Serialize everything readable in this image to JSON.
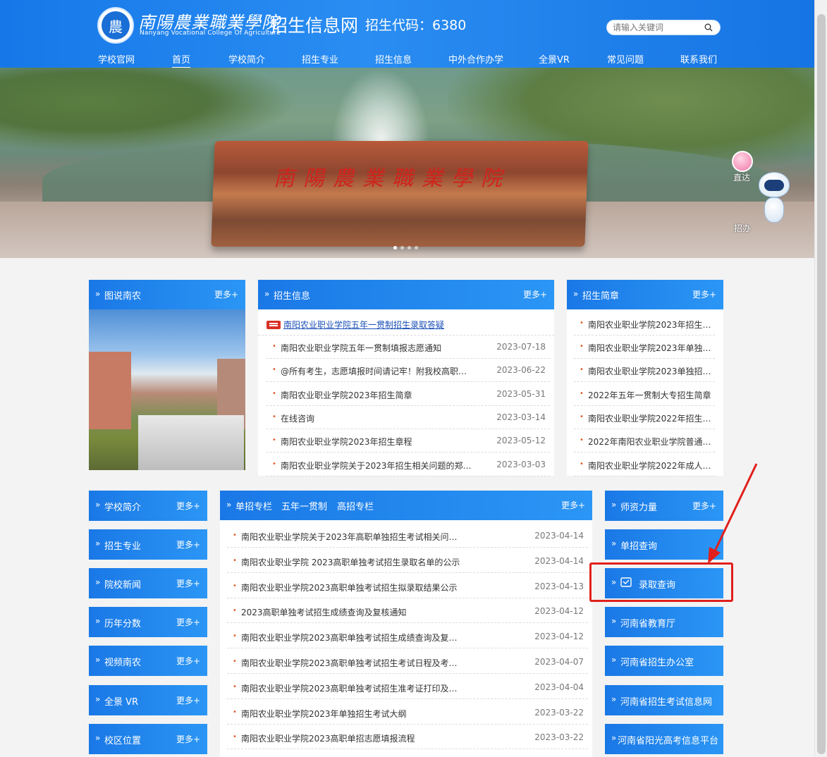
{
  "header": {
    "logo_cn": "南陽農業職業學院",
    "logo_en": "Nanyang Vocational College Of Agriculture",
    "site_title": "招生信息网",
    "enroll_code": "招生代码：6380",
    "search_placeholder": "请输入关键词"
  },
  "nav": [
    "学校官网",
    "首页",
    "学校简介",
    "招生专业",
    "招生信息",
    "中外合作办学",
    "全景VR",
    "常见问题",
    "联系我们"
  ],
  "nav_active": "首页",
  "banner": {
    "stone_text": "南陽農業職業學院",
    "float_straight": "直达",
    "float_robot": "招办"
  },
  "panels": {
    "photo_panel": {
      "title": "图说南农",
      "more": "更多+"
    },
    "news": {
      "title": "招生信息",
      "more": "更多+",
      "featured": "南阳农业职业学院五年一贯制招生录取答疑",
      "items": [
        {
          "text": "南阳农业职业学院五年一贯制填报志愿通知",
          "date": "2023-07-18"
        },
        {
          "text": "@所有考生，志愿填报时间请记牢！附我校高职…",
          "date": "2023-06-22"
        },
        {
          "text": "南阳农业职业学院2023年招生简章",
          "date": "2023-05-31"
        },
        {
          "text": "在线咨询",
          "date": "2023-03-14"
        },
        {
          "text": "南阳农业职业学院2023年招生章程",
          "date": "2023-05-12"
        },
        {
          "text": "南阳农业职业学院关于2023年招生相关问题的郑…",
          "date": "2023-03-03"
        }
      ]
    },
    "brochure": {
      "title": "招生简章",
      "more": "更多+",
      "items": [
        "南阳农业职业学院2023年招生…",
        "南阳农业职业学院2023年单独…",
        "南阳农业职业学院2023单独招…",
        "2022年五年一贯制大专招生简章",
        "南阳农业职业学院2022年招生…",
        "2022年南阳农业职业学院普通…",
        "南阳农业职业学院2022年成人…"
      ]
    },
    "single_exam": {
      "tabs": [
        "单招专栏",
        "五年一贯制",
        "高招专栏"
      ],
      "more": "更多+",
      "items": [
        {
          "text": "南阳农业职业学院关于2023年高职单独招生考试相关问…",
          "date": "2023-04-14"
        },
        {
          "text": "南阳农业职业学院 2023高职单独考试招生录取名单的公示",
          "date": "2023-04-14"
        },
        {
          "text": "南阳农业职业学院2023高职单独考试招生拟录取结果公示",
          "date": "2023-04-13"
        },
        {
          "text": "2023高职单独考试招生成绩查询及复核通知",
          "date": "2023-04-12"
        },
        {
          "text": "南阳农业职业学院2023高职单独考试招生成绩查询及复…",
          "date": "2023-04-12"
        },
        {
          "text": "南阳农业职业学院2023高职单独考试招生考试日程及考…",
          "date": "2023-04-07"
        },
        {
          "text": "南阳农业职业学院2023高职单独考试招生准考证打印及…",
          "date": "2023-04-04"
        },
        {
          "text": "南阳农业职业学院2023年单独招生考试大纲",
          "date": "2023-03-22"
        },
        {
          "text": "南阳农业职业学院2023高职单招志愿填报流程",
          "date": "2023-03-22"
        }
      ]
    }
  },
  "left_buttons": [
    {
      "label": "学校简介",
      "more": "更多+"
    },
    {
      "label": "招生专业",
      "more": "更多+"
    },
    {
      "label": "院校新闻",
      "more": "更多+"
    },
    {
      "label": "历年分数",
      "more": "更多+"
    },
    {
      "label": "视频南农",
      "more": "更多+"
    },
    {
      "label": "全景 VR",
      "more": "更多+"
    },
    {
      "label": "校区位置",
      "more": "更多+"
    }
  ],
  "right_buttons": {
    "faculty": {
      "label": "师资力量",
      "more": "更多+"
    },
    "items": [
      "单招查询",
      "录取查询",
      "河南省教育厅",
      "河南省招生办公室",
      "河南省招生考试信息网",
      "河南省阳光高考信息平台"
    ]
  },
  "colors": {
    "primary": "#1a78e6",
    "highlight": "#e0201c",
    "bullet": "#e05a2b"
  }
}
